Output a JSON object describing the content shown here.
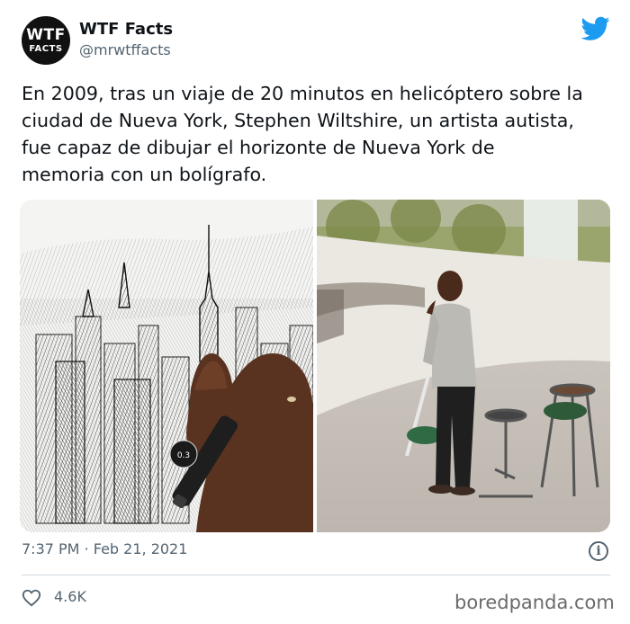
{
  "author": {
    "avatar_line1": "WTF",
    "avatar_line2": "FACTS",
    "display_name": "WTF Facts",
    "handle": "@mrwtffacts"
  },
  "tweet": {
    "text": "En 2009, tras un viaje de 20 minutos en helicóptero sobre la\nciudad de Nueva York, Stephen Wiltshire, un artista autista,\nfue capaz de dibujar el horizonte de Nueva York de\nmemoria con un bolígrafo.",
    "time": "7:37 PM",
    "separator": "·",
    "date": "Feb 21, 2021",
    "like_count": "4.6K"
  },
  "pen_label": "0.3",
  "watermark": "boredpanda.com",
  "icons": {
    "brand": "twitter-bird-icon",
    "info": "info-icon",
    "like": "heart-icon"
  },
  "colors": {
    "twitter_blue": "#1d9bf0",
    "text_primary": "#0f1419",
    "text_secondary": "#536471",
    "divider": "#cfd9de"
  }
}
